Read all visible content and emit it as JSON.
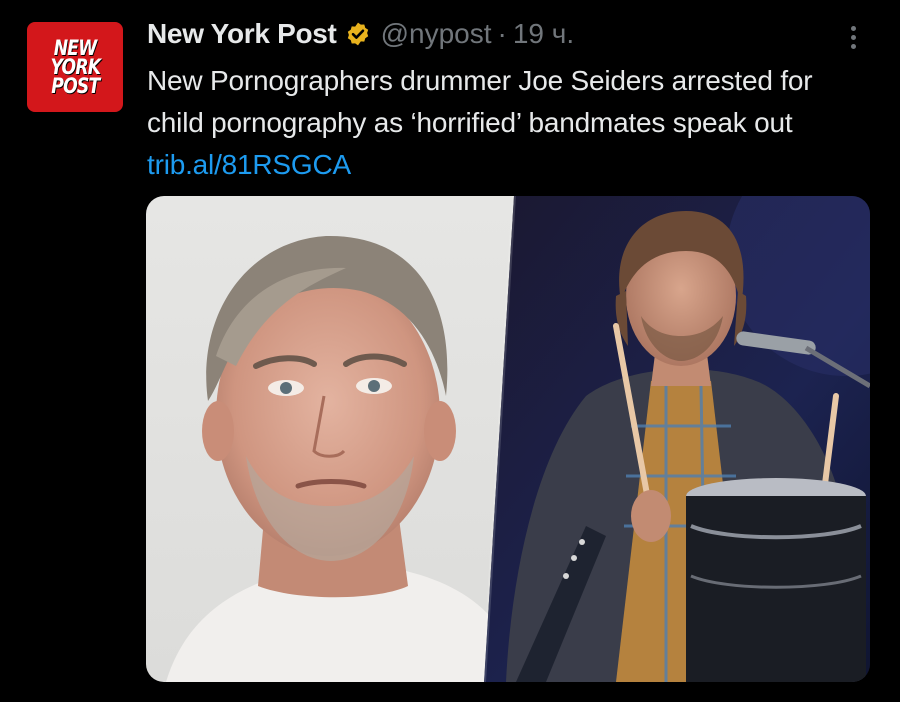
{
  "tweet": {
    "display_name": "New York Post",
    "handle": "@nypost",
    "separator": "·",
    "time": "19 ч.",
    "text": "New Pornographers drummer Joe Seiders arrested for child pornography as ‘horrified’ bandmates speak out ",
    "link": "trib.al/81RSGCA"
  },
  "avatar": {
    "logo_lines": [
      "NEW",
      "YORK",
      "POST"
    ],
    "color": "#d3171b"
  },
  "icons": {
    "verified": "verified-gold-badge-icon",
    "more": "more-vertical-icon"
  },
  "colors": {
    "background": "#000000",
    "text": "#e7e9ea",
    "muted": "#71767b",
    "link": "#1d9bf0",
    "badge": "#e8b21d"
  }
}
